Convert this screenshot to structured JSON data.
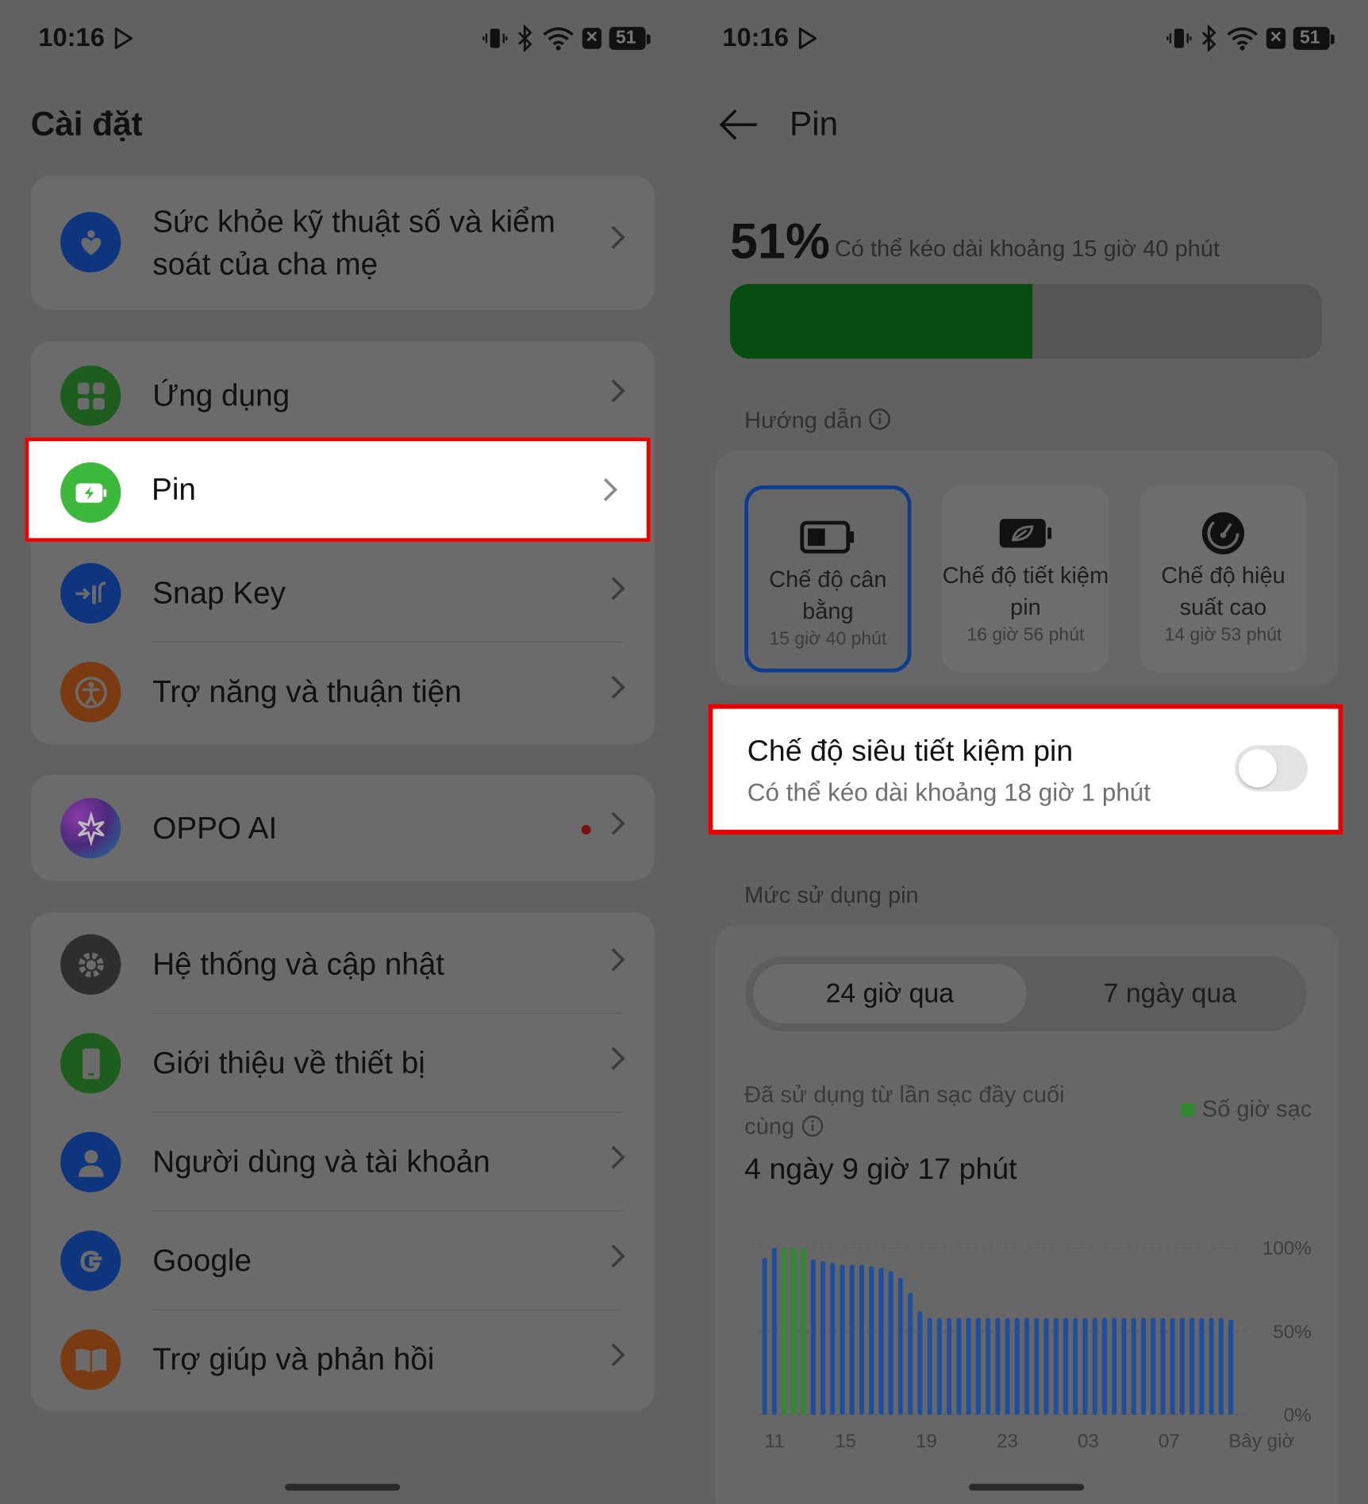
{
  "left": {
    "status": {
      "time": "10:16",
      "battery": "51"
    },
    "title": "Cài đặt",
    "items": [
      {
        "label": "Sức khỏe kỹ thuật số và kiểm soát của cha mẹ"
      },
      {
        "label": "Ứng dụng"
      },
      {
        "label": "Pin"
      },
      {
        "label": "Snap Key"
      },
      {
        "label": "Trợ năng và thuận tiện"
      },
      {
        "label": "OPPO AI"
      },
      {
        "label": "Hệ thống và cập nhật"
      },
      {
        "label": "Giới thiệu về thiết bị"
      },
      {
        "label": "Người dùng và tài khoản"
      },
      {
        "label": "Google"
      },
      {
        "label": "Trợ giúp và phản hồi"
      }
    ]
  },
  "right": {
    "status": {
      "time": "10:16",
      "battery": "51"
    },
    "title": "Pin",
    "battery_percent": "51%",
    "battery_level": 0.51,
    "estimate": "Có thể kéo dài khoảng 15 giờ 40 phút",
    "guide_label": "Hướng dẫn",
    "modes": [
      {
        "title": "Chế độ cân bằng",
        "time": "15 giờ 40 phút",
        "selected": true
      },
      {
        "title": "Chế độ tiết kiệm pin",
        "time": "16 giờ 56 phút",
        "selected": false
      },
      {
        "title": "Chế độ hiệu suất cao",
        "time": "14 giờ 53 phút",
        "selected": false
      }
    ],
    "super_saver": {
      "title": "Chế độ siêu tiết kiệm pin",
      "subtitle": "Có thể kéo dài khoảng 18 giờ 1 phút",
      "on": false
    },
    "usage_label": "Mức sử dụng pin",
    "tabs": {
      "active": "24 giờ qua",
      "inactive": "7 ngày qua"
    },
    "used_since_label": "Đã sử dụng từ lần sạc đầy cuối cùng",
    "legend_charging": "Số giờ sạc",
    "used_since_value": "4 ngày 9 giờ 17 phút"
  },
  "chart_data": {
    "type": "bar",
    "x_tick_labels": [
      "11",
      "15",
      "19",
      "23",
      "03",
      "07",
      "Bây giờ"
    ],
    "y_tick_labels": [
      "100%",
      "50%",
      "0%"
    ],
    "ylim": [
      0,
      100
    ],
    "legend": [
      "Số giờ sạc"
    ],
    "series": [
      {
        "color": "#1f4e9e",
        "values": [
          94,
          100,
          100,
          100,
          100,
          93,
          92,
          91,
          90,
          90,
          90,
          89,
          88,
          86,
          82,
          73,
          62,
          58,
          58,
          58,
          58,
          58,
          58,
          58,
          58,
          58,
          58,
          58,
          58,
          58,
          58,
          58,
          58,
          58,
          58,
          58,
          58,
          58,
          58,
          58,
          58,
          58,
          58,
          58,
          58,
          58,
          58,
          58,
          57
        ]
      },
      {
        "color": "#2f8b2f",
        "values_at": [
          2,
          3,
          4
        ],
        "values": [
          100,
          100,
          100
        ]
      }
    ]
  }
}
